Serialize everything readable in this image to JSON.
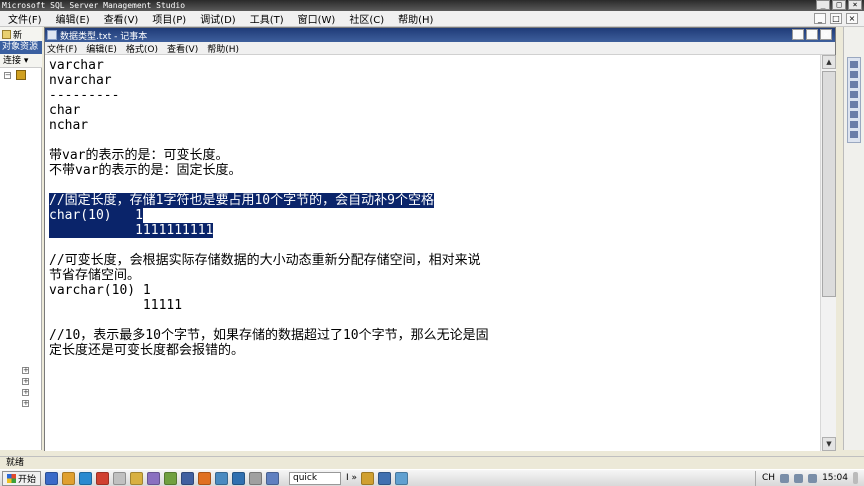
{
  "ssms": {
    "title": "Microsoft SQL Server Management Studio",
    "menu": [
      "文件(F)",
      "编辑(E)",
      "查看(V)",
      "项目(P)",
      "调试(D)",
      "工具(T)",
      "窗口(W)",
      "社区(C)",
      "帮助(H)"
    ],
    "left_toolbar_label": "新",
    "object_explorer_tab": "对象资源",
    "connect_label": "连接",
    "status": "就绪"
  },
  "notepad": {
    "title": "数据类型.txt - 记事本",
    "menu": [
      "文件(F)",
      "编辑(E)",
      "格式(O)",
      "查看(V)",
      "帮助(H)"
    ],
    "lines": [
      {
        "text": "varchar"
      },
      {
        "text": "nvarchar"
      },
      {
        "text": "---------"
      },
      {
        "text": "char"
      },
      {
        "text": "nchar"
      },
      {
        "text": ""
      },
      {
        "text": "带var的表示的是：可变长度。"
      },
      {
        "text": "不带var的表示的是：固定长度。"
      },
      {
        "text": ""
      },
      {
        "text": "//固定长度，存储1字符也是要占用10个字节的，会自动补9个空格",
        "selected": true
      },
      {
        "text": "char(10)   1",
        "selected": true
      },
      {
        "text": "           1111111111",
        "selected": true
      },
      {
        "text": ""
      },
      {
        "text": "//可变长度，会根据实际存储数据的大小动态重新分配存储空间，相对来说"
      },
      {
        "text": "节省存储空间。"
      },
      {
        "text": "varchar(10) 1"
      },
      {
        "text": "            11111"
      },
      {
        "text": ""
      },
      {
        "text": "//10，表示最多10个字节，如果存储的数据超过了10个字节，那么无论是固"
      },
      {
        "text": "定长度还是可变长度都会报错的。"
      }
    ]
  },
  "taskbar": {
    "start": "开始",
    "quick_input": "quick",
    "quick_extra": "I »",
    "lang": "CH",
    "time": "15:04"
  }
}
